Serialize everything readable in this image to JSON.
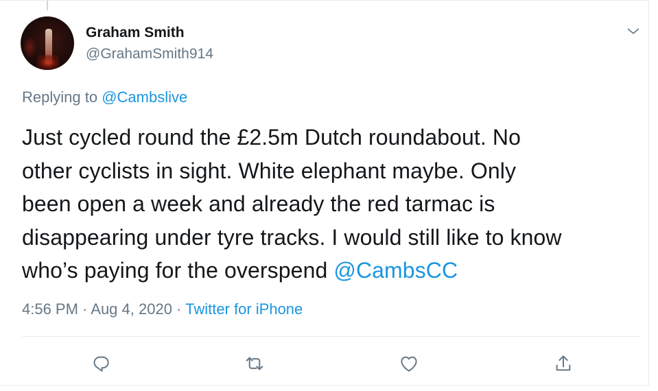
{
  "tweet": {
    "author": {
      "display_name": "Graham Smith",
      "handle": "@GrahamSmith914"
    },
    "replying_to": {
      "prefix": "Replying to",
      "mention": "@Cambslive"
    },
    "text_lines": [
      "Just cycled round the £2.5m Dutch roundabout. No",
      "other cyclists in sight. White elephant maybe. Only",
      "been open a week and already the red tarmac is",
      "disappearing under tyre tracks. I would still like to know",
      "who’s paying for the overspend"
    ],
    "text_mention": "@CambsCC",
    "timestamp": "4:56 PM · Aug 4, 2020 ·",
    "source": "Twitter for iPhone"
  },
  "icons": {
    "caret": "chevron-down-icon",
    "reply": "reply-icon",
    "retweet": "retweet-icon",
    "like": "heart-icon",
    "share": "share-icon"
  },
  "colors": {
    "text": "#14171a",
    "secondary": "#657786",
    "link": "#1b95e0",
    "divider": "#e6ecf0"
  }
}
